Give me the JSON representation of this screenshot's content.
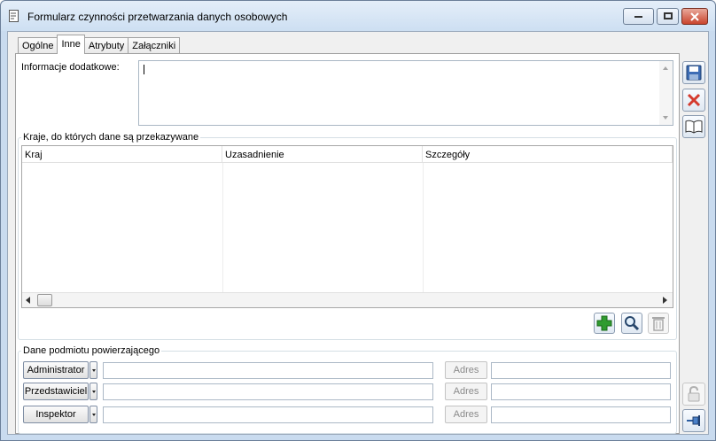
{
  "window": {
    "title": "Formularz czynności przetwarzania danych osobowych"
  },
  "tabs": [
    {
      "label": "Ogólne"
    },
    {
      "label": "Inne"
    },
    {
      "label": "Atrybuty"
    },
    {
      "label": "Załączniki"
    }
  ],
  "info": {
    "label": "Informacje dodatkowe:",
    "value": ""
  },
  "countries": {
    "group_title": "Kraje, do których dane są przekazywane",
    "columns": [
      "Kraj",
      "Uzasadnienie",
      "Szczegóły"
    ]
  },
  "entrusting": {
    "group_title": "Dane podmiotu powierzającego",
    "rows": [
      {
        "button": "Administrator",
        "adres": "Adres"
      },
      {
        "button": "Przedstawiciel",
        "adres": "Adres"
      },
      {
        "button": "Inspektor",
        "adres": "Adres"
      }
    ]
  },
  "icons": {
    "save": "save-icon",
    "cancel": "cancel-icon",
    "book": "book-icon",
    "add": "add-icon",
    "search": "search-icon",
    "delete": "trash-icon",
    "lock": "lock-icon",
    "pin": "pin-icon"
  },
  "colors": {
    "window_bg": "#c9dbef",
    "add_green": "#2f9b2f",
    "cancel_red": "#d43a2e"
  }
}
